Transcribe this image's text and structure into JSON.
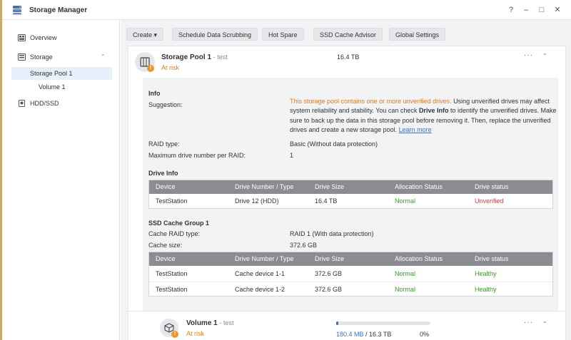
{
  "window": {
    "title": "Storage Manager",
    "controls": [
      "?",
      "–",
      "□",
      "✕"
    ]
  },
  "sidebar": {
    "items": [
      {
        "label": "Overview",
        "icon": "overview-icon"
      },
      {
        "label": "Storage",
        "icon": "storage-icon",
        "expanded": true
      },
      {
        "label": "Storage Pool 1",
        "selected": true
      },
      {
        "label": "Volume 1"
      },
      {
        "label": "HDD/SSD",
        "icon": "hdd-icon"
      }
    ]
  },
  "toolbar": {
    "create": "Create ▾",
    "scrubbing": "Schedule Data Scrubbing",
    "hot_spare": "Hot Spare",
    "ssd_advisor": "SSD Cache Advisor",
    "global": "Global Settings"
  },
  "pool": {
    "name": "Storage Pool 1",
    "sub": "- test",
    "status": "At risk",
    "size": "16.4 TB",
    "more": "···",
    "collapse": "⌃"
  },
  "info": {
    "heading": "Info",
    "suggestion_label": "Suggestion:",
    "suggestion_warning": "This storage pool contains one or more unverified drives.",
    "suggestion_text_1": " Using unverified drives may affect system reliability and stability. You can check ",
    "suggestion_bold": "Drive Info",
    "suggestion_text_2": " to identify the unverified drives. Make sure to back up the data in this storage pool before removing it. Then, replace the unverified drives and create a new storage pool. ",
    "learn_more": "Learn more",
    "raid_label": "RAID type:",
    "raid_value": "Basic (Without data protection)",
    "max_label": "Maximum drive number per RAID:",
    "max_value": "1"
  },
  "drive_info": {
    "heading": "Drive Info",
    "columns": [
      "Device",
      "Drive Number / Type",
      "Drive Size",
      "Allocation Status",
      "Drive status"
    ],
    "rows": [
      [
        "TestStation",
        "Drive 12 (HDD)",
        "16.4 TB",
        "Normal",
        "Unverified"
      ]
    ]
  },
  "ssd_cache": {
    "heading": "SSD Cache Group 1",
    "raid_label": "Cache RAID type:",
    "raid_value": "RAID 1 (With data protection)",
    "size_label": "Cache size:",
    "size_value": "372.6 GB",
    "columns": [
      "Device",
      "Drive Number / Type",
      "Drive Size",
      "Allocation Status",
      "Drive status"
    ],
    "rows": [
      [
        "TestStation",
        "Cache device 1-1",
        "372.6 GB",
        "Normal",
        "Healthy"
      ],
      [
        "TestStation",
        "Cache device 1-2",
        "372.6 GB",
        "Normal",
        "Healthy"
      ]
    ]
  },
  "volume": {
    "name": "Volume 1",
    "sub": "- test",
    "status": "At risk",
    "used": "180.4 MB",
    "total": "/ 16.3 TB",
    "percent": "0%",
    "usage_fraction": 0.01,
    "more": "···",
    "expand": "⌄"
  },
  "colors": {
    "accent": "#3a73c4",
    "warning": "#e07b1a",
    "normal": "#3e9a31",
    "danger": "#c94343"
  }
}
